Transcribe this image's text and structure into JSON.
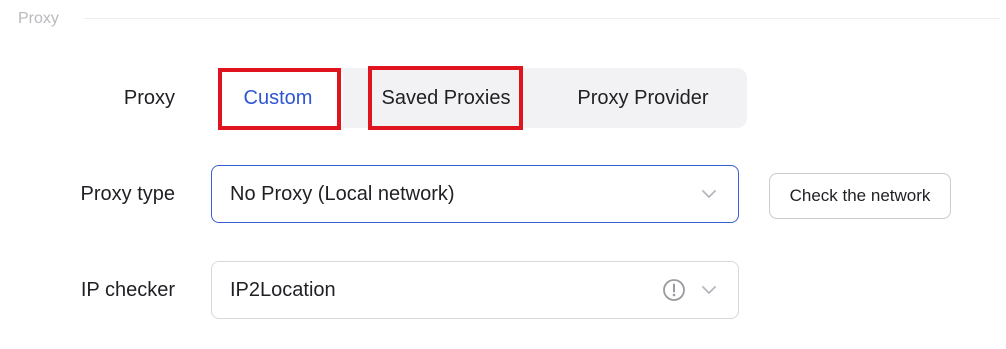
{
  "section": {
    "title": "Proxy"
  },
  "rows": {
    "proxy_label": "Proxy",
    "proxy_type_label": "Proxy type",
    "ip_checker_label": "IP checker"
  },
  "proxy_mode": {
    "options": [
      "Custom",
      "Saved Proxies",
      "Proxy Provider"
    ],
    "selected": "Custom"
  },
  "proxy_type": {
    "value": "No Proxy (Local network)"
  },
  "ip_checker": {
    "value": "IP2Location"
  },
  "check_button": {
    "label": "Check the network"
  },
  "icons": {
    "dropdown": "chevron-down-icon",
    "info": "info-circle-icon"
  },
  "colors": {
    "accent": "#2f56d3",
    "highlight": "#e0141e",
    "focus_border": "#3a5fcf"
  }
}
